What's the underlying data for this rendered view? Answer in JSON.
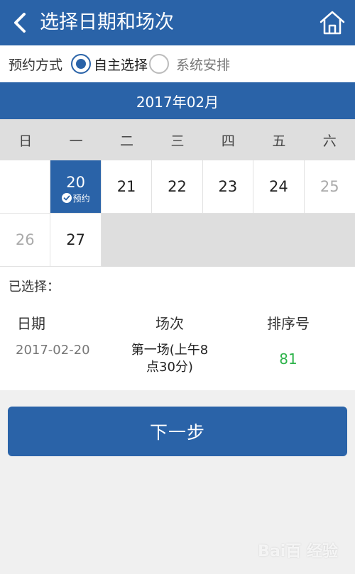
{
  "header": {
    "title": "选择日期和场次",
    "back_icon": "chevron-left-icon",
    "home_icon": "home-icon"
  },
  "booking_mode": {
    "label": "预约方式",
    "options": [
      {
        "label": "自主选择",
        "selected": true
      },
      {
        "label": "系统安排",
        "selected": false
      }
    ]
  },
  "calendar": {
    "month": "2017年02月",
    "weekdays": [
      "日",
      "一",
      "二",
      "三",
      "四",
      "五",
      "六"
    ],
    "days": [
      {
        "day": "20",
        "status": "selected",
        "tag": "预约"
      },
      {
        "day": "21"
      },
      {
        "day": "22"
      },
      {
        "day": "23"
      },
      {
        "day": "24"
      },
      {
        "day": "25",
        "status": "disabled"
      },
      {
        "day": "26",
        "status": "disabled"
      },
      {
        "day": "27"
      }
    ]
  },
  "selection": {
    "title": "已选择：",
    "headers": {
      "date": "日期",
      "session": "场次",
      "order": "排序号"
    },
    "row": {
      "date": "2017-02-20",
      "session_line1": "第一场(上午8",
      "session_line2": "点30分)",
      "order": "81"
    }
  },
  "next_button": {
    "label": "下一步"
  },
  "watermark": "Bai百 经验",
  "colors": {
    "primary": "#2a63a8",
    "order_number": "#2db34a"
  }
}
